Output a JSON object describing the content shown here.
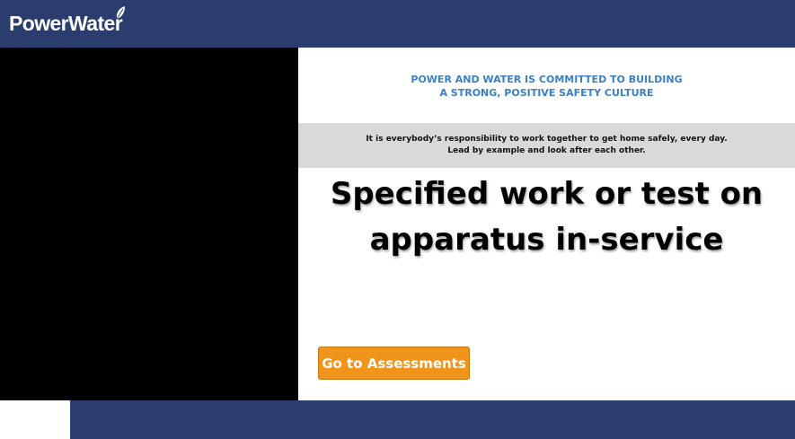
{
  "brand": {
    "logo_text": "PowerWater",
    "logo_icon": "leaf-icon",
    "header_color": "#2b3d6e"
  },
  "commitment": {
    "line1": "POWER AND WATER IS COMMITTED TO BUILDING",
    "line2": "A STRONG, POSITIVE SAFETY CULTURE",
    "color": "#3b7fc4"
  },
  "responsibility": {
    "line1": "It is everybody’s responsibility to work together to get home safely, every day.",
    "line2": "Lead by example and look after each other."
  },
  "title": {
    "line1": "Specified work or test on",
    "line2": "apparatus in-service"
  },
  "cta": {
    "label": "Go to Assessments",
    "color": "#f0941b"
  }
}
